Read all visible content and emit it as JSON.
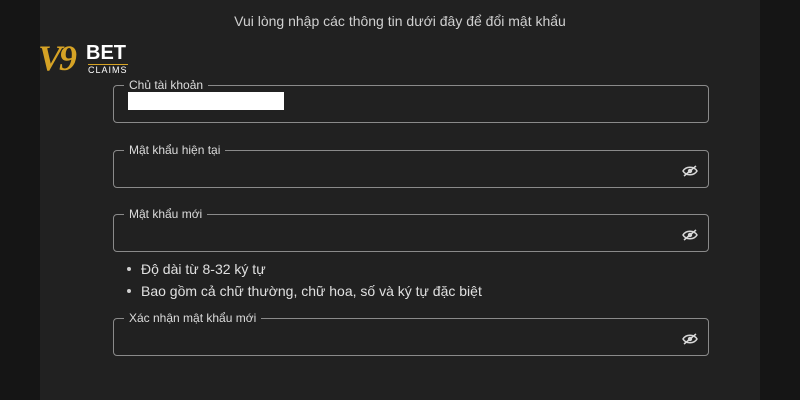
{
  "logo": {
    "mark": "V9",
    "bet": "BET",
    "claims": "CLAIMS"
  },
  "instruction": "Vui lòng nhập các thông tin dưới đây để đổi mật khẩu",
  "fields": [
    {
      "label": "Chủ tài khoản",
      "value_masked": true
    },
    {
      "label": "Mật khẩu hiện tại",
      "icon": "eye-off-icon"
    },
    {
      "label": "Mật khẩu mới",
      "icon": "eye-off-icon"
    },
    {
      "label": "Xác nhận mật khẩu mới",
      "icon": "eye-off-icon"
    }
  ],
  "password_rules": [
    "Độ dài từ 8-32 ký tự",
    "Bao gồm cả chữ thường, chữ hoa, số và ký tự đặc biệt"
  ],
  "colors": {
    "background": "#1a1a1a",
    "panel": "#212121",
    "brand_gold": "#d6a325",
    "border": "#8a8a8a"
  }
}
